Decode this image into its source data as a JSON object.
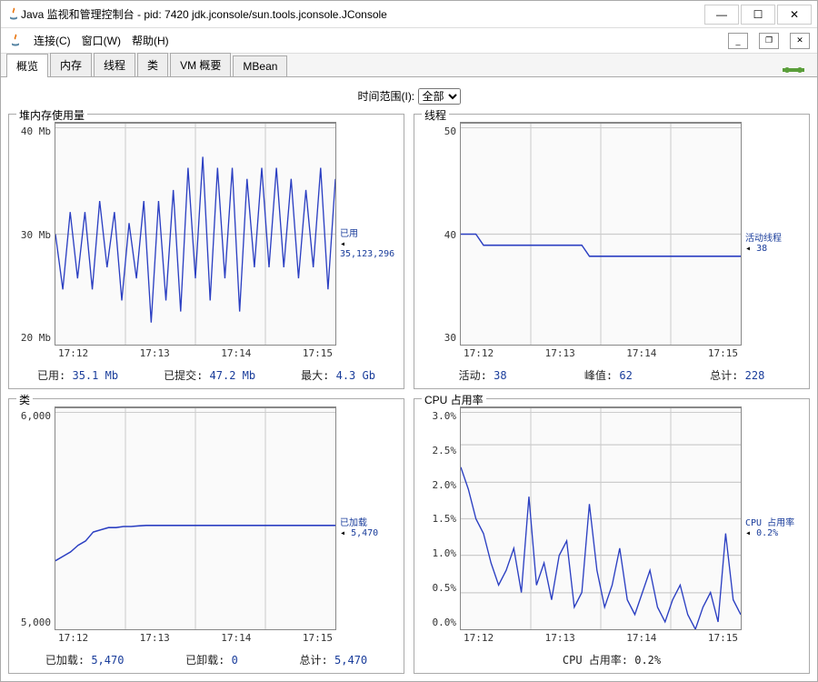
{
  "window": {
    "title": "Java 监视和管理控制台 - pid: 7420 jdk.jconsole/sun.tools.jconsole.JConsole"
  },
  "menu": {
    "connect": "连接(C)",
    "window": "窗口(W)",
    "help": "帮助(H)"
  },
  "tabs": [
    "概览",
    "内存",
    "线程",
    "类",
    "VM 概要",
    "MBean"
  ],
  "timerange": {
    "label": "时间范围(I):",
    "value": "全部"
  },
  "panels": {
    "heap": {
      "title": "堆内存使用量",
      "side_label": "已用",
      "side_value": "35,123,296",
      "stats_labels": [
        "已用:",
        "已提交:",
        "最大:"
      ],
      "stats_values": [
        "35.1  Mb",
        "47.2  Mb",
        "4.3  Gb"
      ]
    },
    "threads": {
      "title": "线程",
      "side_label": "活动线程",
      "side_value": "38",
      "stats_labels": [
        "活动:",
        "峰值:",
        "总计:"
      ],
      "stats_values": [
        "38",
        "62",
        "228"
      ]
    },
    "classes": {
      "title": "类",
      "side_label": "已加载",
      "side_value": "5,470",
      "stats_labels": [
        "已加载:",
        "已卸载:",
        "总计:"
      ],
      "stats_values": [
        "5,470",
        "0",
        "5,470"
      ]
    },
    "cpu": {
      "title": "CPU 占用率",
      "side_label": "CPU 占用率",
      "side_value": "0.2%",
      "stats_label_full": "CPU 占用率: 0.2%"
    }
  },
  "chart_data": [
    {
      "id": "heap",
      "type": "line",
      "title": "堆内存使用量",
      "xlabel": "",
      "ylabel": "Mb",
      "x_ticks": [
        "17:12",
        "17:13",
        "17:14",
        "17:15"
      ],
      "y_ticks": [
        "40 Mb",
        "30 Mb",
        "20 Mb"
      ],
      "ylim": [
        20,
        40
      ],
      "series": [
        {
          "name": "已用",
          "values": [
            30,
            25,
            32,
            26,
            32,
            25,
            33,
            27,
            32,
            24,
            31,
            26,
            33,
            22,
            33,
            24,
            34,
            23,
            36,
            26,
            37,
            24,
            36,
            26,
            36,
            23,
            35,
            27,
            36,
            27,
            36,
            27,
            35,
            26,
            34,
            27,
            36,
            25,
            35
          ]
        }
      ],
      "current_label": "已用 35,123,296"
    },
    {
      "id": "threads",
      "type": "line",
      "title": "线程",
      "xlabel": "",
      "ylabel": "",
      "x_ticks": [
        "17:12",
        "17:13",
        "17:14",
        "17:15"
      ],
      "y_ticks": [
        "50",
        "40",
        "30"
      ],
      "ylim": [
        30,
        50
      ],
      "series": [
        {
          "name": "活动线程",
          "values": [
            40,
            40,
            40,
            39,
            39,
            39,
            39,
            39,
            39,
            39,
            39,
            39,
            39,
            39,
            39,
            39,
            39,
            38,
            38,
            38,
            38,
            38,
            38,
            38,
            38,
            38,
            38,
            38,
            38,
            38,
            38,
            38,
            38,
            38,
            38,
            38,
            38,
            38
          ]
        }
      ],
      "current_label": "活动线程 38"
    },
    {
      "id": "classes",
      "type": "line",
      "title": "类",
      "xlabel": "",
      "ylabel": "",
      "x_ticks": [
        "17:12",
        "17:13",
        "17:14",
        "17:15"
      ],
      "y_ticks": [
        "6,000",
        "5,000"
      ],
      "ylim": [
        5000,
        6000
      ],
      "series": [
        {
          "name": "已加载",
          "values": [
            5310,
            5330,
            5350,
            5380,
            5400,
            5440,
            5450,
            5460,
            5460,
            5465,
            5465,
            5468,
            5470,
            5470,
            5470,
            5470,
            5470,
            5470,
            5470,
            5470,
            5470,
            5470,
            5470,
            5470,
            5470,
            5470,
            5470,
            5470,
            5470,
            5470,
            5470,
            5470,
            5470,
            5470,
            5470,
            5470,
            5470,
            5470
          ]
        }
      ],
      "current_label": "已加载 5,470"
    },
    {
      "id": "cpu",
      "type": "line",
      "title": "CPU 占用率",
      "xlabel": "",
      "ylabel": "%",
      "x_ticks": [
        "17:12",
        "17:13",
        "17:14",
        "17:15"
      ],
      "y_ticks": [
        "3.0%",
        "2.5%",
        "2.0%",
        "1.5%",
        "1.0%",
        "0.5%",
        "0.0%"
      ],
      "ylim": [
        0,
        3.0
      ],
      "series": [
        {
          "name": "CPU 占用率",
          "values": [
            2.2,
            1.9,
            1.5,
            1.3,
            0.9,
            0.6,
            0.8,
            1.1,
            0.5,
            1.8,
            0.6,
            0.9,
            0.4,
            1.0,
            1.2,
            0.3,
            0.5,
            1.7,
            0.8,
            0.3,
            0.6,
            1.1,
            0.4,
            0.2,
            0.5,
            0.8,
            0.3,
            0.1,
            0.4,
            0.6,
            0.2,
            0.0,
            0.3,
            0.5,
            0.1,
            1.3,
            0.4,
            0.2
          ]
        }
      ],
      "current_label": "CPU 占用率 0.2%"
    }
  ]
}
